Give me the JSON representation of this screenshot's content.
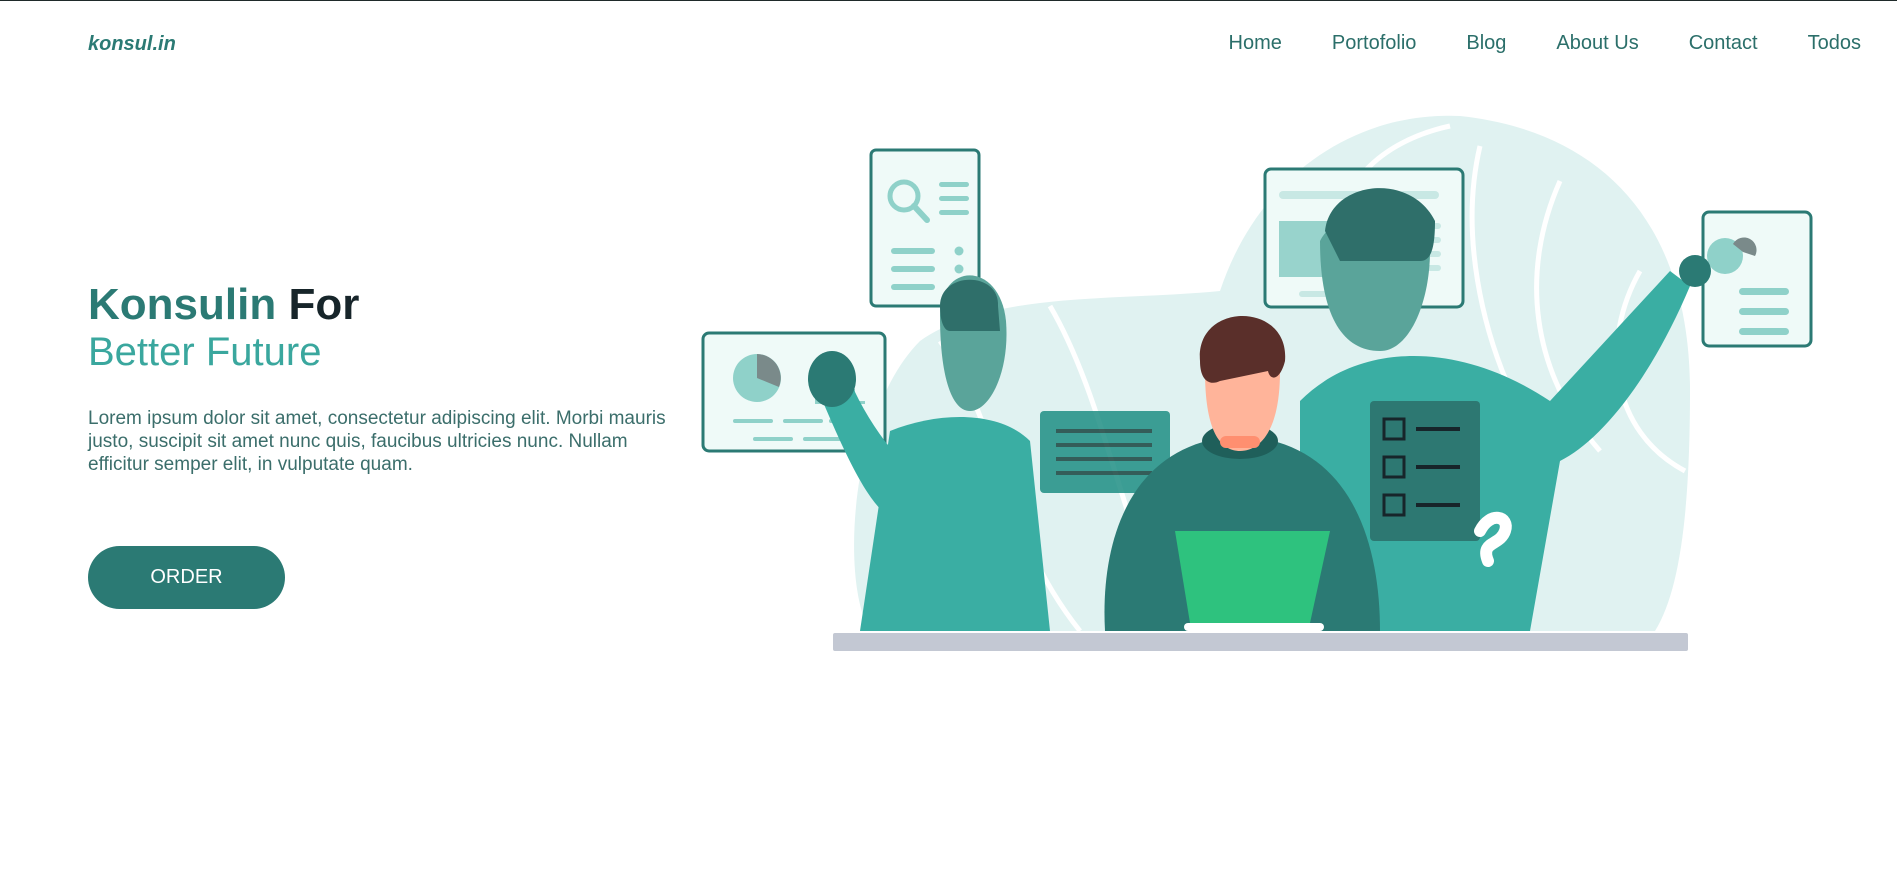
{
  "brand": {
    "name": "konsul.in"
  },
  "nav": {
    "items": [
      {
        "label": "Home"
      },
      {
        "label": "Portofolio"
      },
      {
        "label": "Blog"
      },
      {
        "label": "About Us"
      },
      {
        "label": "Contact"
      },
      {
        "label": "Todos"
      }
    ]
  },
  "hero": {
    "title_accent": "Konsulin",
    "title_rest": "For",
    "subtitle": "Better Future",
    "description": "Lorem ipsum dolor sit amet, consectetur adipiscing elit. Morbi mauris justo, suscipit sit amet nunc quis, faucibus ultricies nunc. Nullam efficitur semper elit, in vulputate quam.",
    "button_label": "ORDER"
  },
  "colors": {
    "primary": "#2b7a74",
    "accent": "#3aa79e",
    "light": "#e0f2f1",
    "laptop": "#2ec27e",
    "desk": "#c3c8d3"
  },
  "illustration": {
    "icon": "team-consulting-illustration"
  }
}
